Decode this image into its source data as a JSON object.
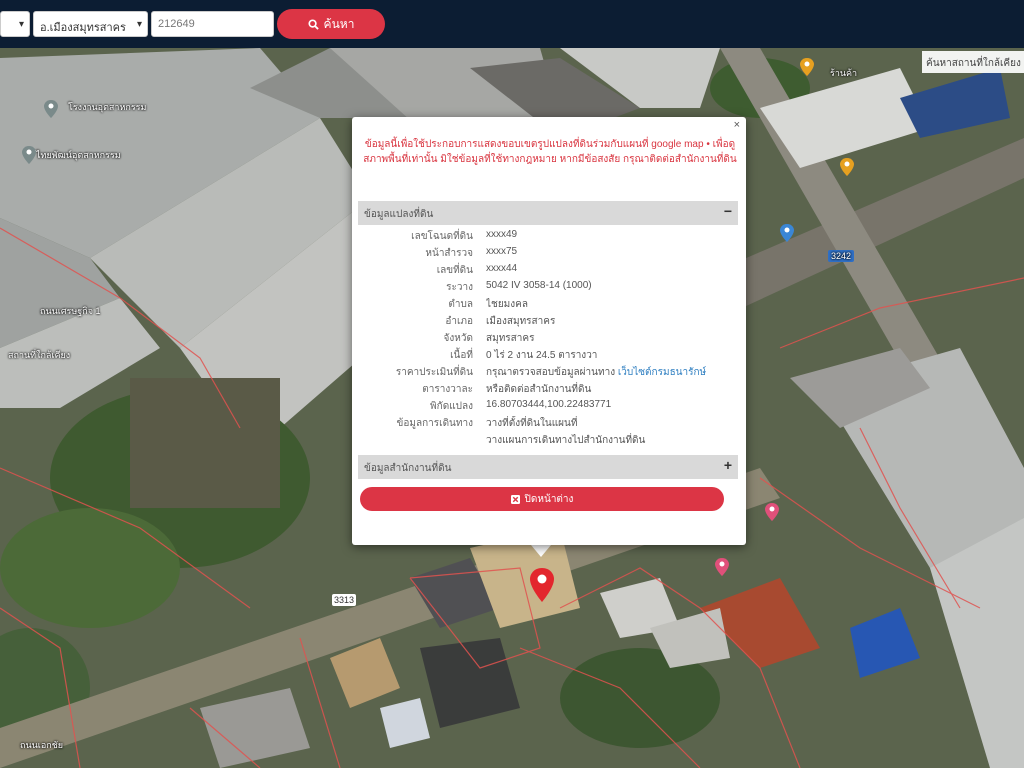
{
  "toolbar": {
    "select1_value": "",
    "select2_value": "อ.เมืองสมุทรสาคร",
    "search_input_value": "212649",
    "search_label": "ค้นหา"
  },
  "map": {
    "corner_label": "ค้นหาสถานที่ใกล้เคียง",
    "labels": [
      "โรงงานอุตสาหกรรม",
      "ไทยพัฒน์อุตสาหกรรม",
      "ถนนเศรษฐกิจ 1",
      "สถานที่ใกล้เคียง",
      "ร้านค้า",
      "ถนนเอกชัย",
      "3313",
      "3242"
    ],
    "road_badge_1": "3313",
    "road_badge_2": "3242"
  },
  "popup": {
    "close_label": "×",
    "notice": "ข้อมูลนี้เพื่อใช้ประกอบการแสดงขอบเขตรูปแปลงที่ดินร่วมกับแผนที่ google map • เพื่อดูสภาพพื้นที่เท่านั้น มิใช่ข้อมูลที่ใช้ทางกฎหมาย หากมีข้อสงสัย กรุณาติดต่อสำนักงานที่ดิน",
    "section1_title": "ข้อมูลแปลงที่ดิน",
    "section1_toggle": "−",
    "rows": [
      {
        "key": "เลขโฉนดที่ดิน",
        "value": "xxxx49"
      },
      {
        "key": "หน้าสำรวจ",
        "value": "xxxx75"
      },
      {
        "key": "เลขที่ดิน",
        "value": "xxxx44"
      },
      {
        "key": "ระวาง",
        "value": "5042 IV 3058-14 (1000)"
      },
      {
        "key": "ตำบล",
        "value": "ไชยมงคล"
      },
      {
        "key": "อำเภอ",
        "value": "เมืองสมุทรสาคร"
      },
      {
        "key": "จังหวัด",
        "value": "สมุทรสาคร"
      },
      {
        "key": "เนื้อที่",
        "value": "0 ไร่ 2 งาน 24.5 ตารางวา"
      },
      {
        "key": "ราคาประเมินที่ดิน",
        "value": "กรุณาตรวจสอบข้อมูลผ่านทาง",
        "link": "เว็บไซต์กรมธนารักษ์"
      },
      {
        "key": "ตารางวาละ",
        "value": "หรือติดต่อสำนักงานที่ดิน"
      },
      {
        "key": "พิกัดแปลง",
        "value": "",
        "link": "16.80703444,100.22483771"
      },
      {
        "key": "ข้อมูลการเดินทาง",
        "value": "",
        "link": "วางที่ตั้งที่ดินในแผนที่"
      },
      {
        "key": "",
        "value": "",
        "link": "วางแผนการเดินทางไปสำนักงานที่ดิน"
      }
    ],
    "section2_title": "ข้อมูลสำนักงานที่ดิน",
    "section2_toggle": "+",
    "action_label": "ปิดหน้าต่าง"
  }
}
